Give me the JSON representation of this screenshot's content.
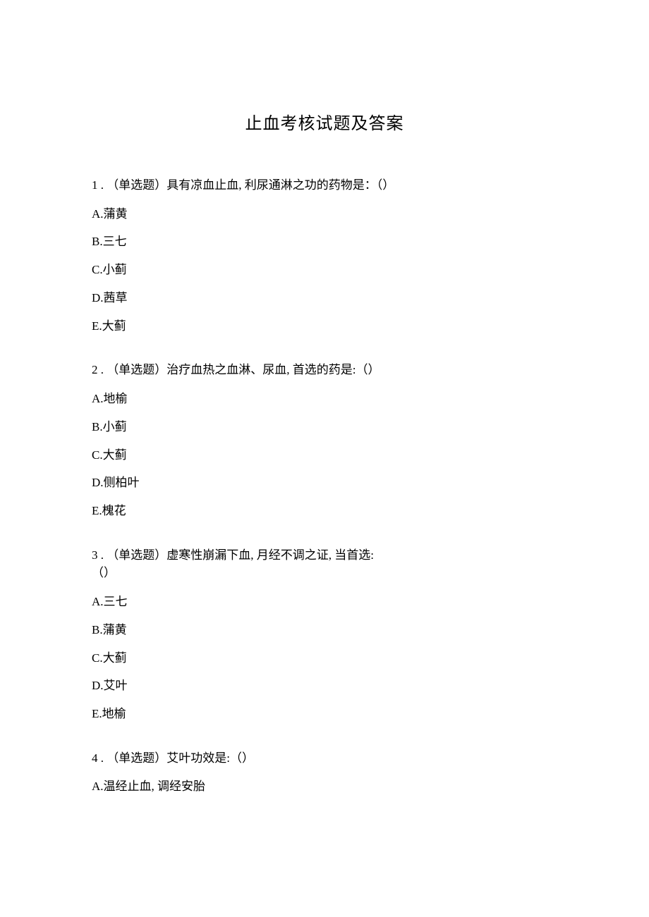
{
  "title": "止血考核试题及答案",
  "questions": [
    {
      "num": "1",
      "type": "（单选题）",
      "stem": "具有凉血止血, 利尿通淋之功的药物是：（）",
      "options": {
        "A": "蒲黄",
        "B": "三七",
        "C": "小蓟",
        "D": "茜草",
        "E": "大蓟"
      }
    },
    {
      "num": "2",
      "type": "（单选题）",
      "stem": "治疗血热之血淋、尿血, 首选的药是:（）",
      "options": {
        "A": "地榆",
        "B": "小蓟",
        "C": "大蓟",
        "D": "侧柏叶",
        "E": "槐花"
      }
    },
    {
      "num": "3",
      "type": "（单选题）",
      "stem": "虚寒性崩漏下血, 月经不调之证, 当首选:",
      "stem_line2": "（）",
      "options": {
        "A": "三七",
        "B": "蒲黄",
        "C": "大蓟",
        "D": "艾叶",
        "E": "地榆"
      }
    },
    {
      "num": "4",
      "type": "（单选题）",
      "stem": "艾叶功效是:（）",
      "options": {
        "A": "温经止血, 调经安胎"
      }
    }
  ]
}
